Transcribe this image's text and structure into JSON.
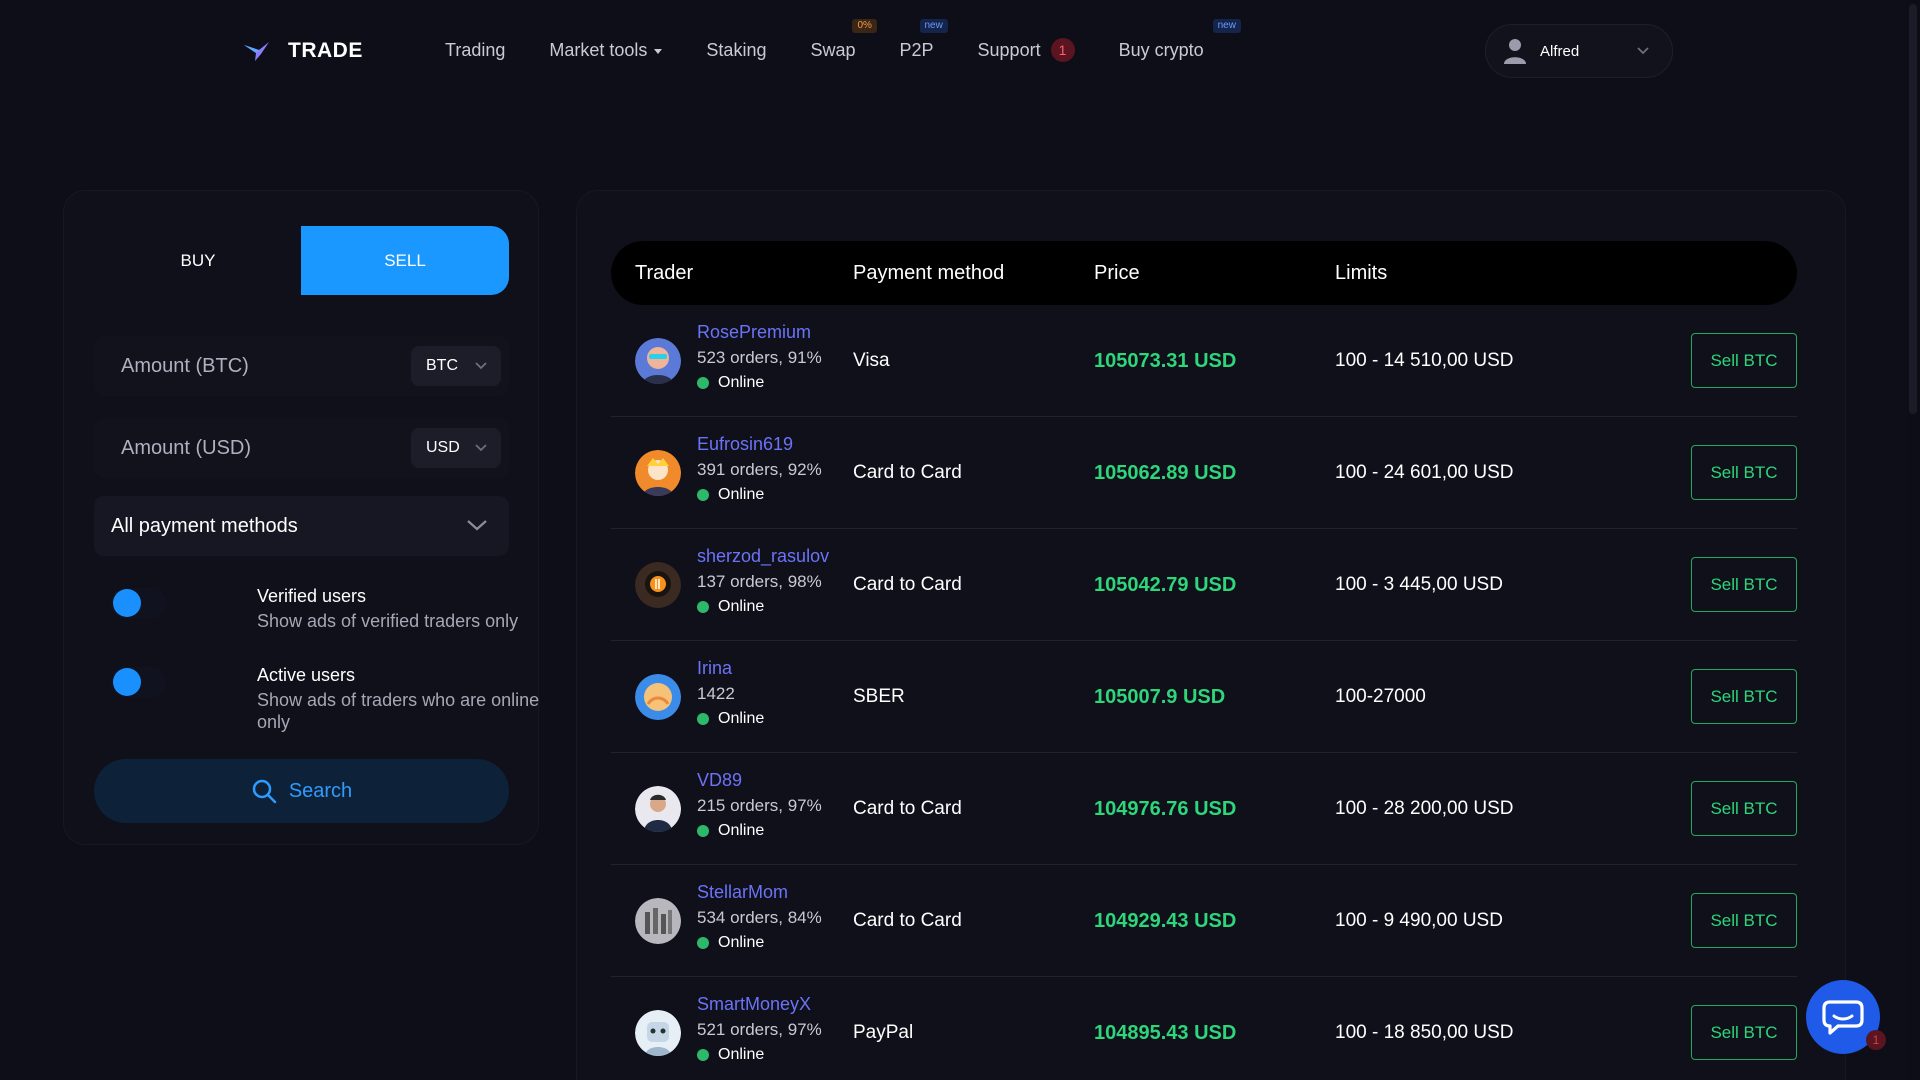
{
  "header": {
    "logo_text": "TRADE",
    "nav": [
      {
        "label": "Trading"
      },
      {
        "label": "Market tools"
      },
      {
        "label": "Staking"
      },
      {
        "label": "Swap",
        "badge": "0%"
      },
      {
        "label": "P2P",
        "badge": "new"
      },
      {
        "label": "Support",
        "count": "1"
      },
      {
        "label": "Buy crypto",
        "badge": "new"
      }
    ],
    "user_name": "Alfred"
  },
  "filter": {
    "tab_buy": "BUY",
    "tab_sell": "SELL",
    "amount_btc_placeholder": "Amount (BTC)",
    "amount_btc_currency": "BTC",
    "amount_usd_placeholder": "Amount (USD)",
    "amount_usd_currency": "USD",
    "payment_methods": "All payment methods",
    "verified_title": "Verified users",
    "verified_desc": "Show ads of verified traders only",
    "active_title": "Active users",
    "active_desc": "Show ads of traders who are online only",
    "search_label": "Search"
  },
  "table": {
    "headers": {
      "trader": "Trader",
      "payment": "Payment method",
      "price": "Price",
      "limits": "Limits"
    },
    "rows": [
      {
        "name": "RosePremium",
        "stats": "523 orders, 91%",
        "status": "Online",
        "payment": "Visa",
        "price": "105073.31 USD",
        "limits": "100 - 14 510,00 USD",
        "action": "Sell BTC"
      },
      {
        "name": "Eufrosin619",
        "stats": "391 orders, 92%",
        "status": "Online",
        "payment": "Card to Card",
        "price": "105062.89 USD",
        "limits": "100 - 24 601,00 USD",
        "action": "Sell BTC"
      },
      {
        "name": "sherzod_rasulov",
        "stats": "137 orders, 98%",
        "status": "Online",
        "payment": "Card to Card",
        "price": "105042.79 USD",
        "limits": "100 - 3 445,00 USD",
        "action": "Sell BTC"
      },
      {
        "name": "Irina",
        "stats": "1422",
        "status": "Online",
        "payment": "SBER",
        "price": "105007.9 USD",
        "limits": "100-27000",
        "action": "Sell BTC"
      },
      {
        "name": "VD89",
        "stats": "215 orders, 97%",
        "status": "Online",
        "payment": "Card to Card",
        "price": "104976.76 USD",
        "limits": "100 - 28 200,00 USD",
        "action": "Sell BTC"
      },
      {
        "name": "StellarMom",
        "stats": "534 orders, 84%",
        "status": "Online",
        "payment": "Card to Card",
        "price": "104929.43 USD",
        "limits": "100 - 9 490,00 USD",
        "action": "Sell BTC"
      },
      {
        "name": "SmartMoneyX",
        "stats": "521 orders, 97%",
        "status": "Online",
        "payment": "PayPal",
        "price": "104895.43 USD",
        "limits": "100 - 18 850,00 USD",
        "action": "Sell BTC"
      }
    ]
  },
  "chat_count": "1",
  "colors": {
    "accent": "#1a98ff",
    "price": "#2ed57a",
    "trader_link": "#6b73f7",
    "online": "#2eb86a"
  }
}
